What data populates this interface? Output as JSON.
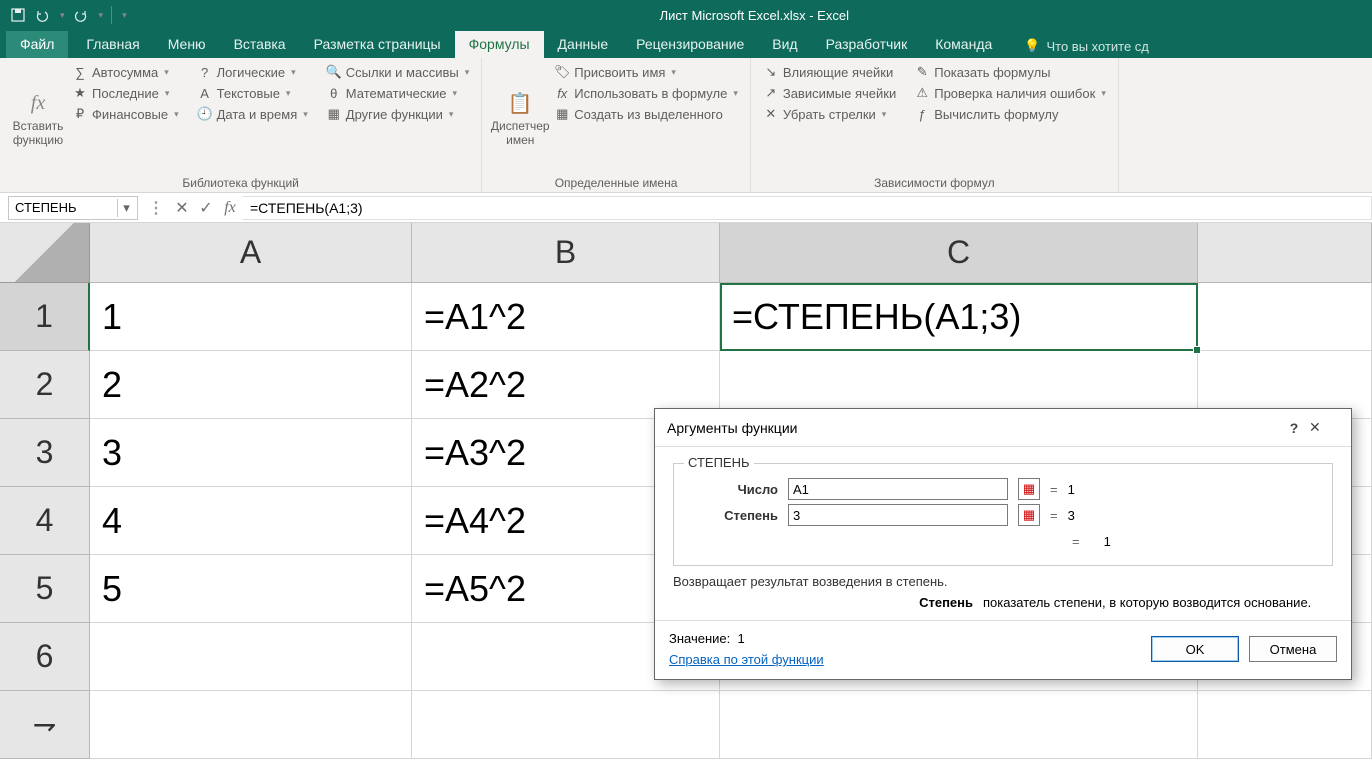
{
  "app": {
    "title": "Лист Microsoft Excel.xlsx - Excel"
  },
  "tabs": {
    "file": "Файл",
    "items": [
      "Главная",
      "Меню",
      "Вставка",
      "Разметка страницы",
      "Формулы",
      "Данные",
      "Рецензирование",
      "Вид",
      "Разработчик",
      "Команда"
    ],
    "active_index": 4,
    "tell_me": "Что вы хотите сд"
  },
  "ribbon": {
    "insert_fn": "Вставить\nфункцию",
    "lib": {
      "caption": "Библиотека функций",
      "autosum": "Автосумма",
      "recent": "Последние",
      "financial": "Финансовые",
      "logical": "Логические",
      "text": "Текстовые",
      "datetime": "Дата и время",
      "lookup": "Ссылки и массивы",
      "math": "Математические",
      "more": "Другие функции"
    },
    "names": {
      "mgr": "Диспетчер\nимен",
      "caption": "Определенные имена",
      "define": "Присвоить имя",
      "use": "Использовать в формуле",
      "create": "Создать из выделенного"
    },
    "audit": {
      "caption": "Зависимости формул",
      "precedents": "Влияющие ячейки",
      "dependents": "Зависимые ячейки",
      "removearrows": "Убрать стрелки",
      "showformulas": "Показать формулы",
      "errorcheck": "Проверка наличия ошибок",
      "evaluate": "Вычислить формулу"
    }
  },
  "formula_bar": {
    "name": "СТЕПЕНЬ",
    "formula": "=СТЕПЕНЬ(A1;3)"
  },
  "grid": {
    "cols": [
      "A",
      "B",
      "C"
    ],
    "active_col": "C",
    "active_row": 1,
    "rows": [
      {
        "n": "1",
        "A": "1",
        "B": "=A1^2",
        "C": "=СТЕПЕНЬ(A1;3)"
      },
      {
        "n": "2",
        "A": "2",
        "B": "=A2^2",
        "C": ""
      },
      {
        "n": "3",
        "A": "3",
        "B": "=A3^2",
        "C": ""
      },
      {
        "n": "4",
        "A": "4",
        "B": "=A4^2",
        "C": ""
      },
      {
        "n": "5",
        "A": "5",
        "B": "=A5^2",
        "C": ""
      },
      {
        "n": "6",
        "A": "",
        "B": "",
        "C": ""
      }
    ]
  },
  "dialog": {
    "title": "Аргументы функции",
    "fname": "СТЕПЕНЬ",
    "arg1_label": "Число",
    "arg1_value": "A1",
    "arg1_result": "1",
    "arg2_label": "Степень",
    "arg2_value": "3",
    "arg2_result": "3",
    "preview_result": "1",
    "description": "Возвращает результат возведения в степень.",
    "arg_name": "Степень",
    "arg_help": "показатель степени, в которую возводится основание.",
    "value_label": "Значение:",
    "value_result": "1",
    "help_link": "Справка по этой функции",
    "ok": "OK",
    "cancel": "Отмена"
  }
}
